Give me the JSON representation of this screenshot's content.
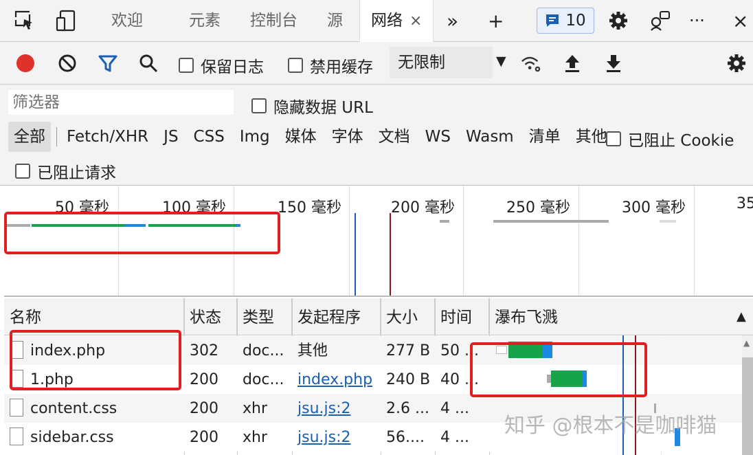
{
  "tabs": {
    "welcome": "欢迎",
    "elements": "元素",
    "console": "控制台",
    "sources": "源",
    "network": "网络",
    "close": "×",
    "more": "»",
    "add": "+",
    "issues_count": "10",
    "menu": "···",
    "close_devtools": "×"
  },
  "toolbar": {
    "preserve_log": "保留日志",
    "disable_cache": "禁用缓存",
    "throttling": "无限制"
  },
  "filter": {
    "placeholder": "筛选器",
    "hide_data_urls": "隐藏数据 URL",
    "types": [
      "全部",
      "Fetch/XHR",
      "JS",
      "CSS",
      "Img",
      "媒体",
      "字体",
      "文档",
      "WS",
      "Wasm",
      "清单",
      "其他"
    ],
    "blocked_cookies": "已阻止 Cookie",
    "blocked_requests": "已阻止请求"
  },
  "overview": {
    "ticks": [
      "50 毫秒",
      "100 毫秒",
      "150 毫秒",
      "200 毫秒",
      "250 毫秒",
      "300 毫秒",
      "35"
    ]
  },
  "table": {
    "headers": {
      "name": "名称",
      "status": "状态",
      "type": "类型",
      "initiator": "发起程序",
      "size": "大小",
      "time": "时间",
      "waterfall": "瀑布飞溅"
    },
    "sort_indicator": "▲",
    "rows": [
      {
        "name": "index.php",
        "status": "302",
        "type": "doc...",
        "initiator": "其他",
        "size": "277 B",
        "time": "50 ..."
      },
      {
        "name": "1.php",
        "status": "200",
        "type": "doc...",
        "initiator": "index.php",
        "size": "240 B",
        "time": "40 ..."
      },
      {
        "name": "content.css",
        "status": "200",
        "type": "xhr",
        "initiator": "jsu.js:2",
        "size": "2.6 ...",
        "time": "4 ..."
      },
      {
        "name": "sidebar.css",
        "status": "200",
        "type": "xhr",
        "initiator": "jsu.js:2",
        "size": "56....",
        "time": "4 ..."
      }
    ]
  },
  "watermark": "知乎 @根本不是咖啡猫",
  "colors": {
    "record": "#e0312a",
    "waiting": "#17a34a",
    "download": "#1e88e5",
    "dom_line": "#1a5fb4",
    "load_line": "#8b1a1a",
    "annotation": "#e02020"
  }
}
